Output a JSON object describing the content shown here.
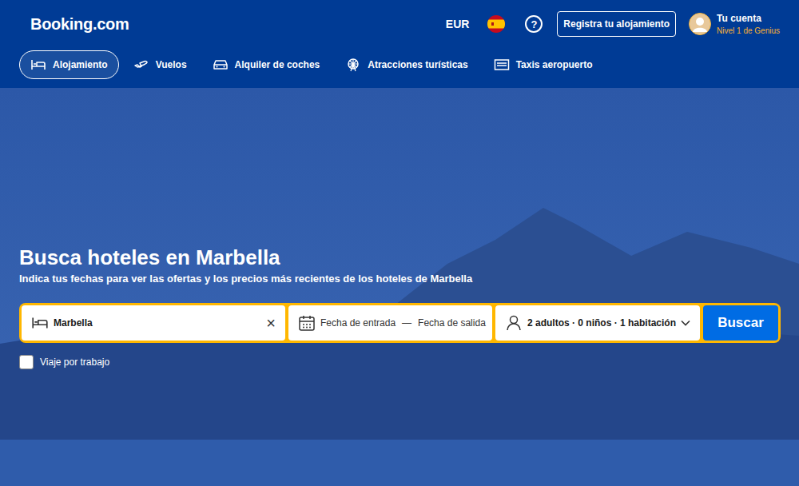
{
  "logo": "Booking.com",
  "header": {
    "currency": "EUR",
    "help": "?",
    "register_button": "Registra tu alojamiento",
    "account": {
      "name": "Tu cuenta",
      "level": "Nivel 1 de Genius"
    }
  },
  "nav": [
    {
      "label": "Alojamiento",
      "selected": true
    },
    {
      "label": "Vuelos",
      "selected": false
    },
    {
      "label": "Alquiler de coches",
      "selected": false
    },
    {
      "label": "Atracciones turísticas",
      "selected": false
    },
    {
      "label": "Taxis aeropuerto",
      "selected": false
    }
  ],
  "hero": {
    "title": "Busca hoteles en Marbella",
    "subtitle": "Indica tus fechas para ver las ofertas y los precios más recientes de los hoteles de Marbella"
  },
  "search": {
    "destination": "Marbella",
    "clear": "×",
    "checkin_placeholder": "Fecha de entrada",
    "separator": "—",
    "checkout_placeholder": "Fecha de salida",
    "guests": "2 adultos · 0 niños · 1 habitación",
    "button": "Buscar"
  },
  "business_trip": {
    "label": "Viaje por trabajo",
    "checked": false
  }
}
